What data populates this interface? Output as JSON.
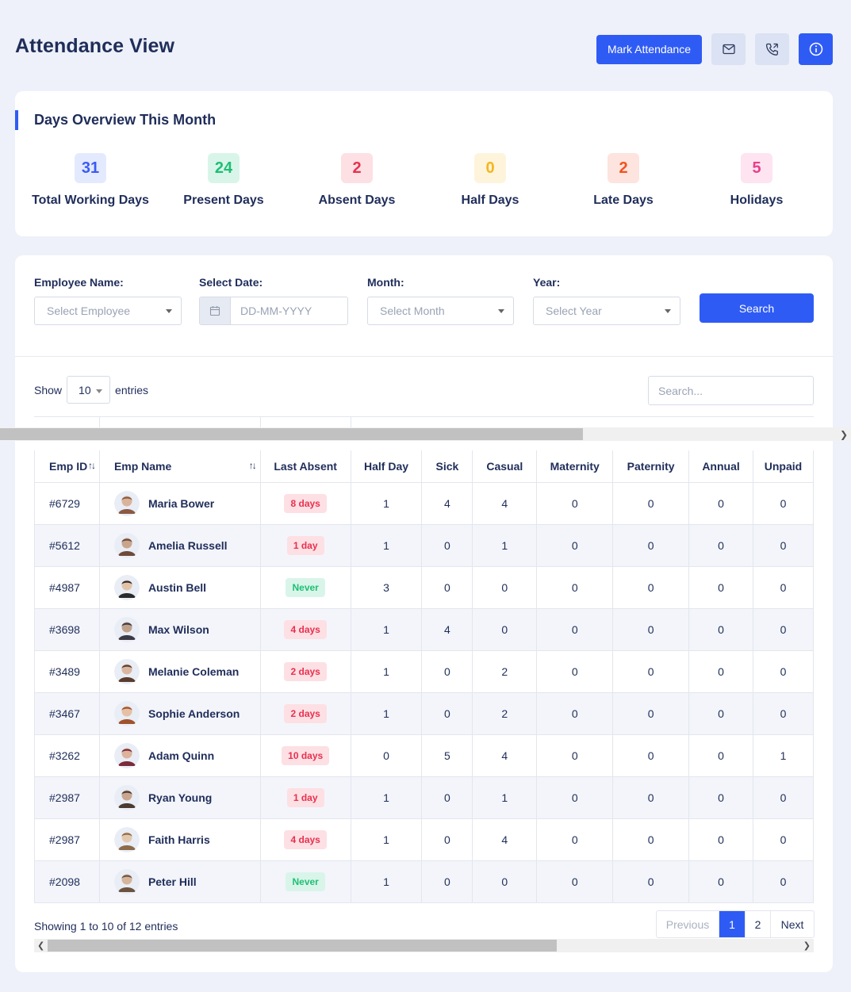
{
  "header": {
    "title": "Attendance View",
    "mark_attendance_label": "Mark Attendance",
    "icons": [
      "mail-icon",
      "phone-icon",
      "info-icon"
    ]
  },
  "overview": {
    "title": "Days Overview This Month",
    "stats": [
      {
        "value": "31",
        "label": "Total Working Days",
        "color": "#3b5bf5",
        "bg": "#e4eafe"
      },
      {
        "value": "24",
        "label": "Present Days",
        "color": "#1fbf74",
        "bg": "#d9f5ea"
      },
      {
        "value": "2",
        "label": "Absent Days",
        "color": "#e8304f",
        "bg": "#fde0e4"
      },
      {
        "value": "0",
        "label": "Half Days",
        "color": "#f5b61d",
        "bg": "#fef4dc"
      },
      {
        "value": "2",
        "label": "Late Days",
        "color": "#f4511e",
        "bg": "#fde4de"
      },
      {
        "value": "5",
        "label": "Holidays",
        "color": "#e83e8c",
        "bg": "#fde4f0"
      }
    ]
  },
  "filters": {
    "employee_label": "Employee Name:",
    "employee_placeholder": "Select Employee",
    "date_label": "Select Date:",
    "date_placeholder": "DD-MM-YYYY",
    "month_label": "Month:",
    "month_placeholder": "Select Month",
    "year_label": "Year:",
    "year_placeholder": "Select Year",
    "search_label": "Search"
  },
  "table_controls": {
    "show_label": "Show",
    "entries_value": "10",
    "entries_label": "entries",
    "search_placeholder": "Search..."
  },
  "table": {
    "columns": [
      "Emp ID",
      "Emp Name",
      "Last Absent",
      "Half Day",
      "Sick",
      "Casual",
      "Maternity",
      "Paternity",
      "Annual",
      "Unpaid"
    ],
    "rows": [
      {
        "id": "#6729",
        "name": "Maria Bower",
        "last_absent": "8 days",
        "status": "red",
        "half": "1",
        "sick": "4",
        "casual": "4",
        "maternity": "0",
        "paternity": "0",
        "annual": "0",
        "unpaid": "0"
      },
      {
        "id": "#5612",
        "name": "Amelia Russell",
        "last_absent": "1 day",
        "status": "red",
        "half": "1",
        "sick": "0",
        "casual": "1",
        "maternity": "0",
        "paternity": "0",
        "annual": "0",
        "unpaid": "0"
      },
      {
        "id": "#4987",
        "name": "Austin Bell",
        "last_absent": "Never",
        "status": "green",
        "half": "3",
        "sick": "0",
        "casual": "0",
        "maternity": "0",
        "paternity": "0",
        "annual": "0",
        "unpaid": "0"
      },
      {
        "id": "#3698",
        "name": "Max Wilson",
        "last_absent": "4 days",
        "status": "red",
        "half": "1",
        "sick": "4",
        "casual": "0",
        "maternity": "0",
        "paternity": "0",
        "annual": "0",
        "unpaid": "0"
      },
      {
        "id": "#3489",
        "name": "Melanie Coleman",
        "last_absent": "2 days",
        "status": "red",
        "half": "1",
        "sick": "0",
        "casual": "2",
        "maternity": "0",
        "paternity": "0",
        "annual": "0",
        "unpaid": "0"
      },
      {
        "id": "#3467",
        "name": "Sophie Anderson",
        "last_absent": "2 days",
        "status": "red",
        "half": "1",
        "sick": "0",
        "casual": "2",
        "maternity": "0",
        "paternity": "0",
        "annual": "0",
        "unpaid": "0"
      },
      {
        "id": "#3262",
        "name": "Adam Quinn",
        "last_absent": "10 days",
        "status": "red",
        "half": "0",
        "sick": "5",
        "casual": "4",
        "maternity": "0",
        "paternity": "0",
        "annual": "0",
        "unpaid": "1"
      },
      {
        "id": "#2987",
        "name": "Ryan Young",
        "last_absent": "1 day",
        "status": "red",
        "half": "1",
        "sick": "0",
        "casual": "1",
        "maternity": "0",
        "paternity": "0",
        "annual": "0",
        "unpaid": "0"
      },
      {
        "id": "#2987",
        "name": "Faith Harris",
        "last_absent": "4 days",
        "status": "red",
        "half": "1",
        "sick": "0",
        "casual": "4",
        "maternity": "0",
        "paternity": "0",
        "annual": "0",
        "unpaid": "0"
      },
      {
        "id": "#2098",
        "name": "Peter Hill",
        "last_absent": "Never",
        "status": "green",
        "half": "1",
        "sick": "0",
        "casual": "0",
        "maternity": "0",
        "paternity": "0",
        "annual": "0",
        "unpaid": "0"
      }
    ]
  },
  "footer": {
    "info": "Showing 1 to 10 of 12 entries",
    "prev_label": "Previous",
    "pages": [
      "1",
      "2"
    ],
    "next_label": "Next"
  },
  "colors": {
    "accent": "#2f5bf5",
    "heading": "#1f2d5a",
    "page_bg": "#eef1f9"
  }
}
